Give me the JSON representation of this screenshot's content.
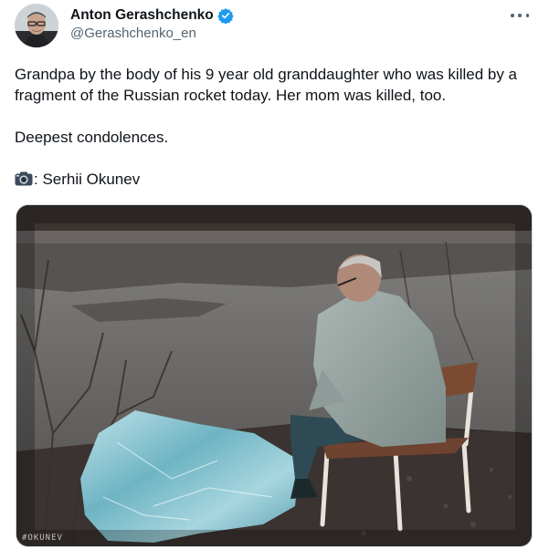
{
  "author": {
    "display_name": "Anton Gerashchenko",
    "handle": "@Gerashchenko_en",
    "verified_icon": "verified-badge-icon",
    "verified_color": "#1d9bf0"
  },
  "more_icon": "more-options-icon",
  "tweet": {
    "line1": "Grandpa by the body of his 9 year old granddaughter who was killed by a fragment of the Russian rocket today. Her mom was killed, too.",
    "line2": "Deepest condolences.",
    "credit_icon": "camera-icon",
    "credit": ": Serhii Okunev"
  },
  "media": {
    "watermark": "#OKUNEV"
  }
}
